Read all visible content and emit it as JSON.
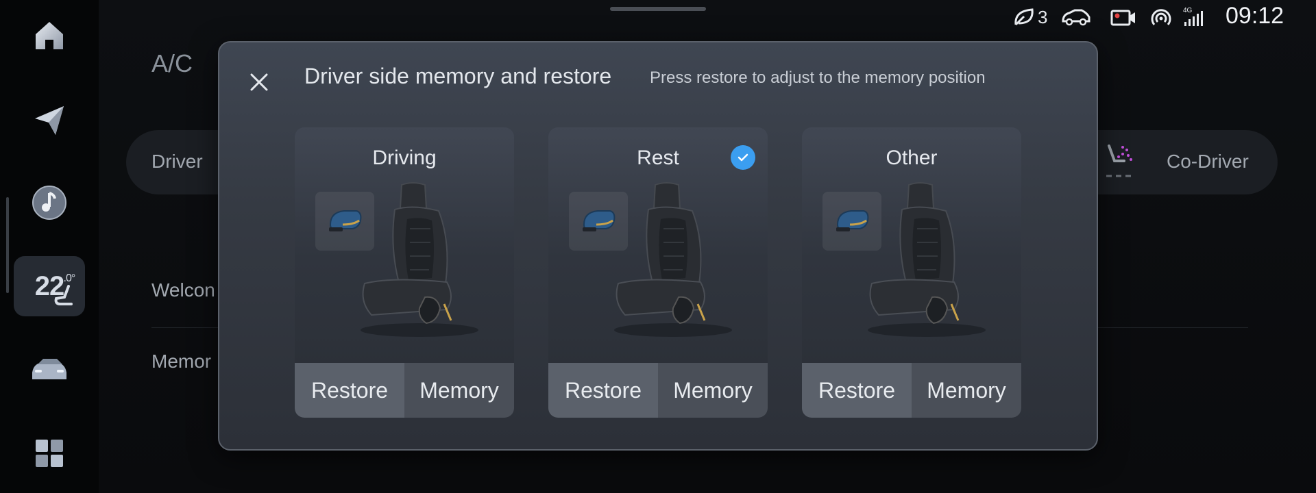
{
  "status_bar": {
    "notification_count": "3",
    "network": "4G",
    "time": "09:12"
  },
  "sidebar": {
    "items": [
      {
        "icon": "home-icon"
      },
      {
        "icon": "navigation-icon"
      },
      {
        "icon": "music-icon"
      },
      {
        "label": "22",
        "label_sup": ".0°",
        "icon": "seat-heat-icon",
        "active": true
      },
      {
        "icon": "car-icon"
      },
      {
        "icon": "apps-grid-icon"
      }
    ]
  },
  "background": {
    "title": "A/C",
    "driver_label": "Driver",
    "codriver_label": "Co-Driver",
    "welcome_label": "Welcon",
    "memory_label": "Memor"
  },
  "dialog": {
    "title": "Driver side memory and restore",
    "subtitle": "Press restore to adjust to the memory position",
    "cards": [
      {
        "name": "Driving",
        "restore_label": "Restore",
        "memory_label": "Memory",
        "selected": false
      },
      {
        "name": "Rest",
        "restore_label": "Restore",
        "memory_label": "Memory",
        "selected": true
      },
      {
        "name": "Other",
        "restore_label": "Restore",
        "memory_label": "Memory",
        "selected": false
      }
    ]
  },
  "colors": {
    "accent_check": "#3b9ef0",
    "mirror_blue": "#2e5c8a",
    "mirror_gold": "#c9a24a",
    "codriver_icon": "#c04fd9"
  }
}
